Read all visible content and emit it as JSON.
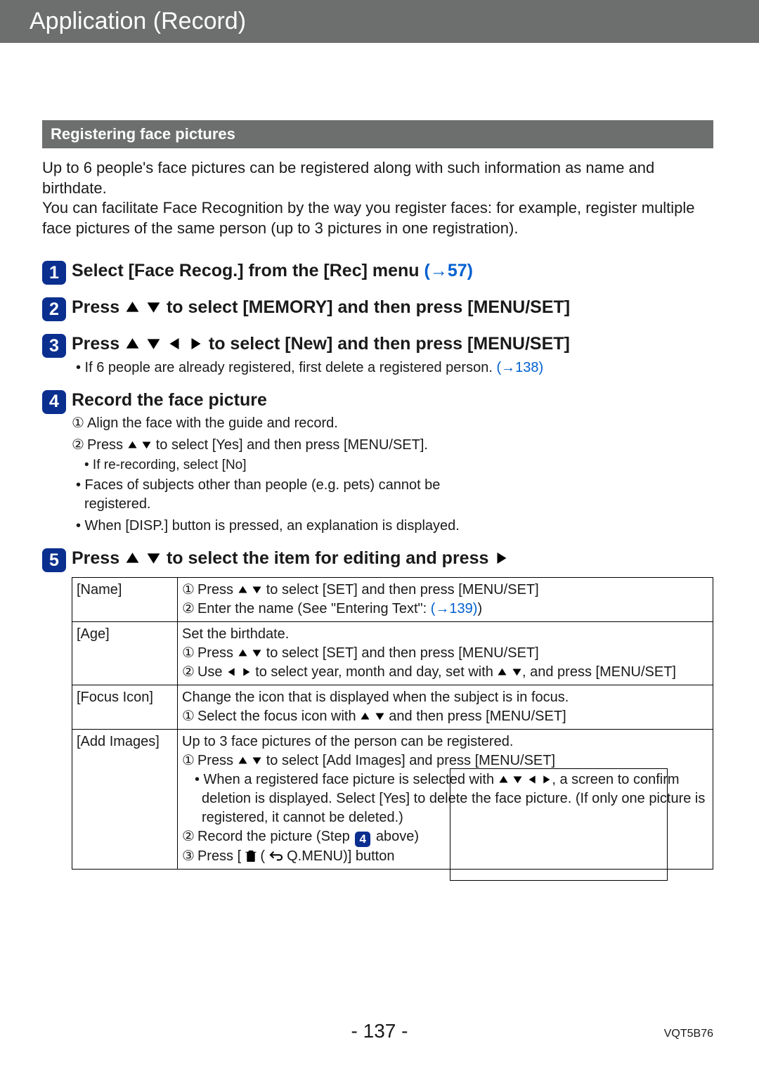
{
  "header": {
    "breadcrumb": "Application (Record)"
  },
  "section_title": "Registering face pictures",
  "intro": "Up to 6 people's face pictures can be registered along with such information as name and birthdate.\nYou can facilitate Face Recognition by the way you register faces: for example, register multiple face pictures of the same person (up to 3 pictures in one registration).",
  "steps": [
    {
      "title": "Select [Face Recog.] from the [Rec] menu ",
      "link": "(→57)"
    },
    {
      "title_a": "Press ",
      "title_b": " to select [MEMORY] and then press [MENU/SET]"
    },
    {
      "title_a": "Press ",
      "title_b": " to select [New] and then press [MENU/SET]",
      "sub": "• If 6 people are already registered, first delete a registered person. ",
      "link": "(→138)"
    },
    {
      "title": "Record the face picture",
      "l1": "Align the face with the guide and record.",
      "l2a": "Press ",
      "l2b": " to select [Yes] and then press [MENU/SET].",
      "note": "• If re-recording, select [No]",
      "b1": "• Faces of subjects other than people (e.g. pets) cannot be registered.",
      "b2": "• When [DISP.] button is pressed, an explanation is displayed."
    },
    {
      "title_a": "Press ",
      "title_b": " to select the item for editing and press "
    }
  ],
  "table": [
    {
      "label": "[Name]",
      "l1a": "Press ",
      "l1b": " to select [SET] and then press [MENU/SET]",
      "l2a": "Enter the name (See \"Entering Text\": ",
      "link": "(→139)",
      "l2b": ")"
    },
    {
      "label": "[Age]",
      "l0": "Set the birthdate.",
      "l1a": "Press ",
      "l1b": " to select [SET] and then press [MENU/SET]",
      "l2a": "Use ",
      "l2b": " to select year, month and day, set with ",
      "l2c": ", and press [MENU/SET]"
    },
    {
      "label": "[Focus Icon]",
      "l0": "Change the icon that is displayed when the subject is in focus.",
      "l1a": "Select the focus icon with ",
      "l1b": " and then press [MENU/SET]"
    },
    {
      "label": "[Add Images]",
      "l0": "Up to 3 face pictures of the person can be registered.",
      "l1a": "Press ",
      "l1b": " to select [Add Images] and press [MENU/SET]",
      "b1a": "• When a registered face picture is selected with ",
      "b1b": ", a screen to confirm deletion is displayed. Select [Yes] to delete the face picture. (If only one picture is registered, it cannot be deleted.)",
      "l2a": "Record the picture (Step ",
      "l2b": " above)",
      "l3a": "Press [",
      "l3b": " (",
      "l3c": " Q.MENU)] button"
    }
  ],
  "footer": {
    "page": "- 137 -",
    "code": "VQT5B76"
  }
}
